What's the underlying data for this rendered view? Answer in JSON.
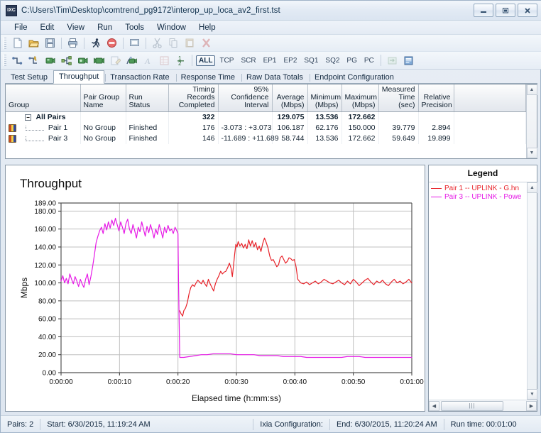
{
  "window": {
    "title": "C:\\Users\\Tim\\Desktop\\comtrend_pg9172\\interop_up_loca_av2_first.tst",
    "app_icon_label": "IXC",
    "minimize_label": "Minimize",
    "maximize_label": "Restore",
    "close_label": "Close"
  },
  "menu": {
    "items": [
      {
        "label": "File"
      },
      {
        "label": "Edit"
      },
      {
        "label": "View"
      },
      {
        "label": "Run"
      },
      {
        "label": "Tools"
      },
      {
        "label": "Window"
      },
      {
        "label": "Help"
      }
    ]
  },
  "toolbar1": {
    "icons": [
      {
        "name": "new-document-icon",
        "glyph": "⬜",
        "enabled": true
      },
      {
        "name": "open-folder-icon",
        "glyph": "📁",
        "enabled": true
      },
      {
        "name": "save-icon",
        "glyph": "💾",
        "enabled": true
      },
      {
        "name": "print-icon",
        "glyph": "🖨",
        "enabled": true
      },
      {
        "name": "run-icon",
        "glyph": "🏃",
        "enabled": true
      },
      {
        "name": "stop-icon",
        "glyph": "⛔",
        "enabled": true
      },
      {
        "name": "monitor-icon",
        "glyph": "🗔",
        "enabled": true
      },
      {
        "name": "cut-icon",
        "glyph": "✂",
        "enabled": false
      },
      {
        "name": "copy-icon",
        "glyph": "❐",
        "enabled": false
      },
      {
        "name": "paste-icon",
        "glyph": "📋",
        "enabled": false
      },
      {
        "name": "delete-icon",
        "glyph": "✖",
        "enabled": false
      }
    ]
  },
  "toolbar2": {
    "icons": [
      {
        "name": "pair-setup-icon",
        "glyph": "⤵",
        "enabled": true
      },
      {
        "name": "add-pair-icon",
        "glyph": "⤵",
        "enabled": true
      },
      {
        "name": "endpoint-icon",
        "glyph": "📹",
        "enabled": true
      },
      {
        "name": "network-icon",
        "glyph": "⛓",
        "enabled": true
      },
      {
        "name": "camera-icon",
        "glyph": "📷",
        "enabled": true
      },
      {
        "name": "dual-camera-icon",
        "glyph": "📽",
        "enabled": true
      },
      {
        "name": "edit-script-icon",
        "glyph": "📝",
        "enabled": false
      },
      {
        "name": "video-pair-icon",
        "glyph": "🎥",
        "enabled": true
      },
      {
        "name": "font-icon",
        "glyph": "A",
        "enabled": false
      },
      {
        "name": "grid-icon",
        "glyph": "⊞",
        "enabled": false
      },
      {
        "name": "half-icon",
        "glyph": "½",
        "enabled": true
      }
    ],
    "filters": [
      {
        "label": "ALL",
        "active": true
      },
      {
        "label": "TCP",
        "active": false
      },
      {
        "label": "SCR",
        "active": false
      },
      {
        "label": "EP1",
        "active": false
      },
      {
        "label": "EP2",
        "active": false
      },
      {
        "label": "SQ1",
        "active": false
      },
      {
        "label": "SQ2",
        "active": false
      },
      {
        "label": "PG",
        "active": false
      },
      {
        "label": "PC",
        "active": false
      }
    ],
    "trailing_icons": [
      {
        "name": "export-icon",
        "glyph": "🗂",
        "enabled": false
      },
      {
        "name": "report-icon",
        "glyph": "🗒",
        "enabled": true
      }
    ]
  },
  "tabs": [
    {
      "label": "Test Setup",
      "active": false
    },
    {
      "label": "Throughput",
      "active": true
    },
    {
      "label": "Transaction Rate",
      "active": false
    },
    {
      "label": "Response Time",
      "active": false
    },
    {
      "label": "Raw Data Totals",
      "active": false
    },
    {
      "label": "Endpoint Configuration",
      "active": false
    }
  ],
  "grid": {
    "columns": [
      {
        "label": "Group",
        "align": "left"
      },
      {
        "label": "Pair Group\nName",
        "align": "left"
      },
      {
        "label": "Run Status",
        "align": "left"
      },
      {
        "label": "Timing Records\nCompleted",
        "align": "right"
      },
      {
        "label": "95% Confidence\nInterval",
        "align": "right"
      },
      {
        "label": "Average\n(Mbps)",
        "align": "right"
      },
      {
        "label": "Minimum\n(Mbps)",
        "align": "right"
      },
      {
        "label": "Maximum\n(Mbps)",
        "align": "right"
      },
      {
        "label": "Measured\nTime (sec)",
        "align": "right"
      },
      {
        "label": "Relative\nPrecision",
        "align": "right"
      }
    ],
    "rows": [
      {
        "type": "group",
        "expander": "−",
        "group": "All Pairs",
        "pair_group_name": "",
        "run_status": "",
        "timing_records": "322",
        "confidence_interval": "",
        "average": "129.075",
        "minimum": "13.536",
        "maximum": "172.662",
        "measured_time": "",
        "relative_precision": ""
      },
      {
        "type": "pair",
        "group": "Pair 1",
        "pair_group_name": "No Group",
        "run_status": "Finished",
        "timing_records": "176",
        "confidence_interval": "-3.073 : +3.073",
        "average": "106.187",
        "minimum": "62.176",
        "maximum": "150.000",
        "measured_time": "39.779",
        "relative_precision": "2.894"
      },
      {
        "type": "pair",
        "group": "Pair 3",
        "pair_group_name": "No Group",
        "run_status": "Finished",
        "timing_records": "146",
        "confidence_interval": "-11.689 : +11.689",
        "average": "58.744",
        "minimum": "13.536",
        "maximum": "172.662",
        "measured_time": "59.649",
        "relative_precision": "19.899"
      }
    ]
  },
  "legend": {
    "title": "Legend",
    "items": [
      {
        "label": "Pair 1 -- UPLINK - G.hn",
        "color": "#e8232a"
      },
      {
        "label": "Pair 3 -- UPLINK - Powe",
        "color": "#e619e6"
      }
    ]
  },
  "status": {
    "pairs": "Pairs: 2",
    "start": "Start: 6/30/2015, 11:19:24 AM",
    "configuration": "Ixia Configuration:",
    "end": "End: 6/30/2015, 11:20:24 AM",
    "runtime": "Run time: 00:01:00"
  },
  "chart_data": {
    "type": "line",
    "title": "Throughput",
    "xlabel": "Elapsed time (h:mm:ss)",
    "ylabel": "Mbps",
    "grid": true,
    "legend_position": "right-panel",
    "ylim": [
      0,
      189
    ],
    "yticks": [
      0,
      20,
      40,
      60,
      80,
      100,
      120,
      140,
      160,
      180,
      189
    ],
    "ytick_labels": [
      "0.00",
      "20.00",
      "40.00",
      "60.00",
      "80.00",
      "100.00",
      "120.00",
      "140.00",
      "160.00",
      "180.00",
      "189.00"
    ],
    "xlim": [
      0,
      60
    ],
    "xticks": [
      0,
      10,
      20,
      30,
      40,
      50,
      60
    ],
    "xtick_labels": [
      "0:00:00",
      "0:00:10",
      "0:00:20",
      "0:00:30",
      "0:00:40",
      "0:00:50",
      "0:01:00"
    ],
    "series": [
      {
        "name": "Pair 1 -- UPLINK - G.hn",
        "color": "#e8232a",
        "x": [
          20.3,
          20.5,
          20.8,
          21.0,
          21.3,
          21.6,
          21.9,
          22.2,
          22.5,
          22.8,
          23.1,
          23.4,
          23.7,
          24.0,
          24.3,
          24.6,
          24.9,
          25.2,
          25.5,
          25.8,
          26.1,
          26.4,
          26.7,
          27.0,
          27.3,
          27.6,
          27.9,
          28.2,
          28.5,
          28.8,
          29.1,
          29.3,
          29.5,
          29.7,
          29.9,
          30.1,
          30.3,
          30.6,
          30.9,
          31.2,
          31.5,
          31.8,
          32.1,
          32.4,
          32.7,
          33.0,
          33.3,
          33.6,
          33.9,
          34.2,
          34.5,
          34.8,
          35.1,
          35.4,
          35.7,
          36.0,
          36.3,
          36.6,
          36.9,
          37.2,
          37.5,
          37.8,
          38.1,
          38.4,
          38.7,
          39.0,
          39.3,
          39.6,
          39.9,
          40.2,
          40.5,
          41.0,
          41.5,
          42.0,
          42.5,
          43.0,
          43.5,
          44.0,
          44.5,
          45.0,
          45.5,
          46.0,
          46.5,
          47.0,
          47.5,
          48.0,
          48.5,
          49.0,
          49.5,
          50.0,
          50.5,
          51.0,
          51.5,
          52.0,
          52.5,
          53.0,
          53.5,
          54.0,
          54.5,
          55.0,
          55.5,
          56.0,
          56.5,
          57.0,
          57.5,
          58.0,
          58.5,
          59.0,
          59.5,
          60.0
        ],
        "y": [
          69,
          66,
          63,
          69,
          72,
          78,
          88,
          95,
          98,
          96,
          100,
          103,
          101,
          99,
          103,
          99,
          96,
          104,
          99,
          95,
          91,
          99,
          104,
          108,
          113,
          110,
          112,
          113,
          117,
          122,
          116,
          107,
          119,
          132,
          143,
          140,
          146,
          141,
          144,
          139,
          143,
          138,
          148,
          141,
          147,
          140,
          145,
          137,
          141,
          135,
          144,
          150,
          145,
          139,
          130,
          125,
          126,
          122,
          118,
          120,
          128,
          130,
          126,
          122,
          124,
          128,
          127,
          125,
          126,
          118,
          104,
          100,
          99,
          101,
          98,
          100,
          102,
          99,
          101,
          104,
          102,
          100,
          99,
          101,
          103,
          100,
          98,
          102,
          99,
          104,
          101,
          97,
          100,
          103,
          105,
          101,
          98,
          102,
          100,
          103,
          99,
          97,
          101,
          104,
          100,
          102,
          99,
          101,
          104,
          100
        ]
      },
      {
        "name": "Pair 3 -- UPLINK - Powe",
        "color": "#e619e6",
        "x": [
          0.0,
          0.3,
          0.6,
          0.9,
          1.2,
          1.5,
          1.8,
          2.1,
          2.4,
          2.7,
          3.0,
          3.3,
          3.6,
          3.9,
          4.2,
          4.5,
          4.8,
          5.1,
          5.4,
          5.7,
          6.0,
          6.3,
          6.6,
          6.9,
          7.2,
          7.5,
          7.8,
          8.1,
          8.4,
          8.7,
          9.0,
          9.3,
          9.6,
          9.9,
          10.2,
          10.5,
          10.8,
          11.1,
          11.4,
          11.7,
          12.0,
          12.3,
          12.6,
          12.9,
          13.2,
          13.5,
          13.8,
          14.1,
          14.4,
          14.7,
          15.0,
          15.3,
          15.6,
          15.9,
          16.2,
          16.5,
          16.8,
          17.1,
          17.4,
          17.7,
          18.0,
          18.3,
          18.6,
          18.9,
          19.2,
          19.5,
          19.8,
          20.0,
          20.1,
          20.3,
          21.0,
          22.0,
          23.0,
          24.0,
          25.0,
          26.0,
          27.0,
          28.0,
          29.0,
          30.0,
          31.0,
          32.0,
          33.0,
          34.0,
          35.0,
          36.0,
          37.0,
          38.0,
          39.0,
          40.0,
          41.0,
          42.0,
          43.0,
          44.0,
          45.0,
          46.0,
          47.0,
          48.0,
          49.0,
          50.0,
          51.0,
          52.0,
          53.0,
          54.0,
          55.0,
          56.0,
          57.0,
          58.0,
          59.0,
          60.0
        ],
        "y": [
          102,
          108,
          100,
          105,
          99,
          110,
          104,
          99,
          107,
          102,
          96,
          104,
          99,
          95,
          104,
          110,
          98,
          107,
          118,
          131,
          145,
          152,
          158,
          162,
          155,
          166,
          159,
          168,
          161,
          170,
          164,
          172,
          165,
          158,
          168,
          162,
          155,
          166,
          171,
          160,
          155,
          165,
          158,
          150,
          162,
          157,
          168,
          160,
          152,
          163,
          156,
          165,
          158,
          150,
          160,
          154,
          165,
          158,
          150,
          162,
          156,
          164,
          158,
          160,
          155,
          162,
          158,
          155,
          100,
          17,
          17,
          18,
          19,
          20,
          20,
          21,
          21,
          21,
          21,
          20,
          20,
          20,
          20,
          19,
          19,
          19,
          19,
          18,
          18,
          18,
          18,
          17,
          17,
          17,
          17,
          17,
          17,
          17,
          18,
          18,
          18,
          17,
          17,
          17,
          17,
          17,
          17,
          17,
          17,
          17
        ]
      }
    ]
  }
}
